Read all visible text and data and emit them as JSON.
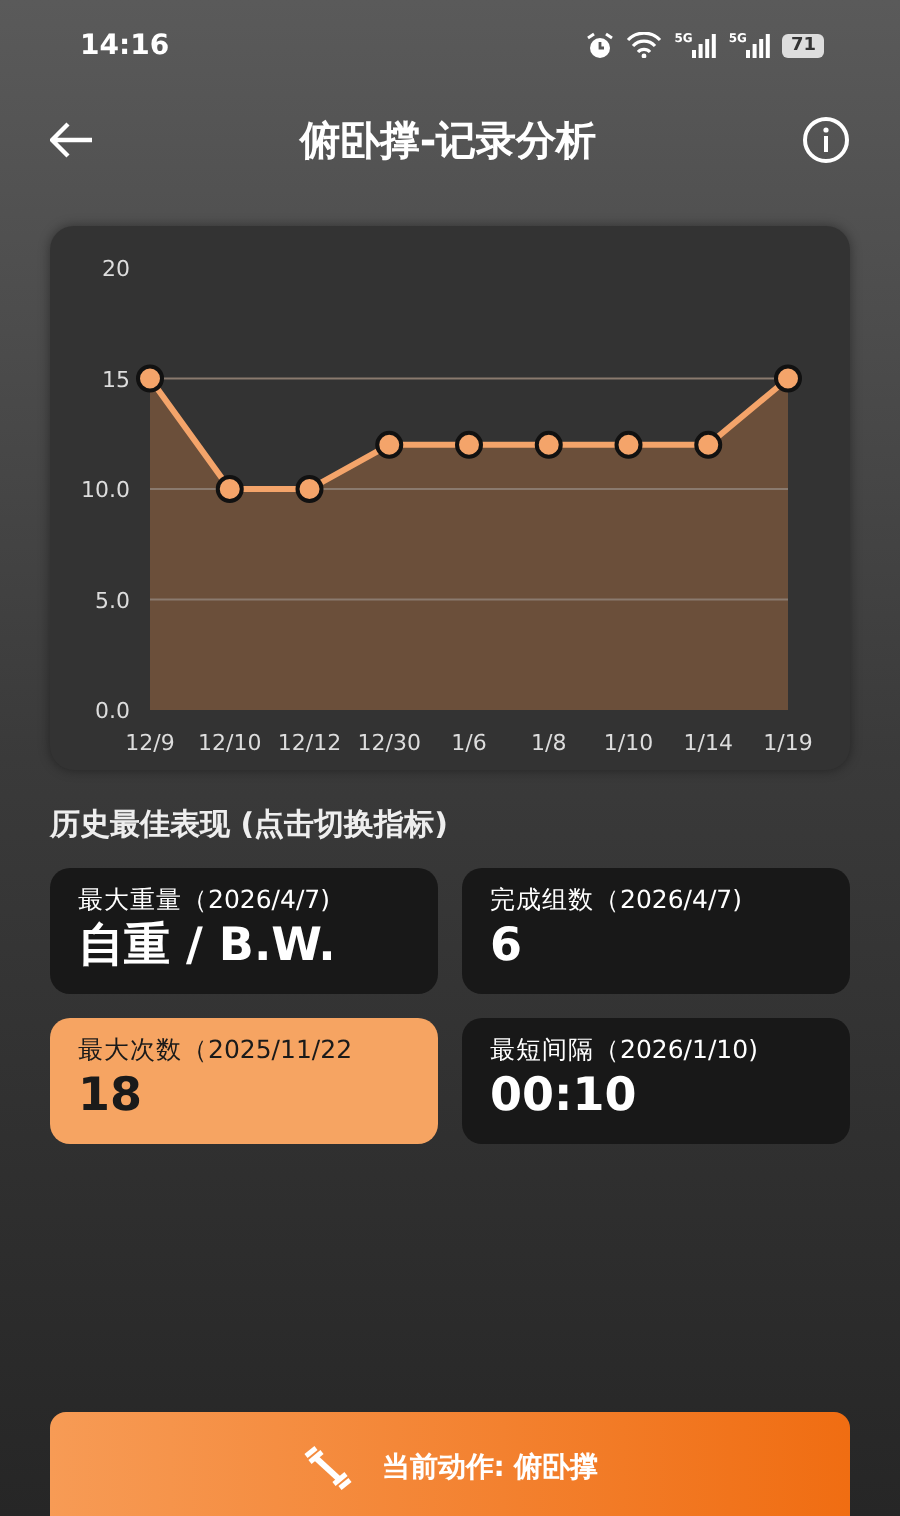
{
  "status_bar": {
    "time": "14:16",
    "signals": [
      "5G",
      "5G"
    ],
    "battery": "71"
  },
  "header": {
    "title": "俯卧撑-记录分析"
  },
  "chart": {
    "chart_data": {
      "type": "area",
      "categories": [
        "12/9",
        "12/10",
        "12/12",
        "12/30",
        "1/6",
        "1/8",
        "1/10",
        "1/14",
        "1/19"
      ],
      "grid": true,
      "series": [
        {
          "color": "#f4a46a",
          "values": [
            15,
            10,
            10,
            12,
            12,
            12,
            12,
            12,
            15
          ]
        }
      ],
      "ylim": [
        0,
        20
      ],
      "yticks": [
        {
          "value": 0,
          "label": "0.0"
        },
        {
          "value": 5,
          "label": "5.0"
        },
        {
          "value": 10,
          "label": "10.0"
        },
        {
          "value": 15,
          "label": "15"
        },
        {
          "value": 20,
          "label": "20"
        }
      ]
    }
  },
  "best": {
    "title": "历史最佳表现 (点击切换指标)",
    "cards": [
      {
        "label": "最大重量（2026/4/7)",
        "value": "自重 / B.W.",
        "selected": false
      },
      {
        "label": "完成组数（2026/4/7)",
        "value": "6",
        "selected": false
      },
      {
        "label": "最大次数（2025/11/22",
        "value": "18",
        "selected": true
      },
      {
        "label": "最短间隔（2026/1/10)",
        "value": "00:10",
        "selected": false
      }
    ]
  },
  "action_button": {
    "label": "当前动作: 俯卧撑"
  }
}
